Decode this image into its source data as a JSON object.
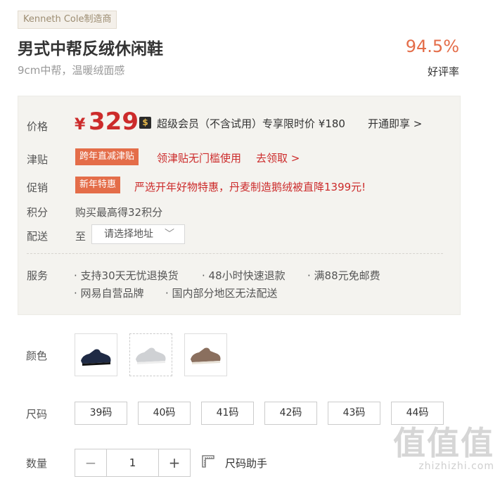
{
  "brand_tag": "Kenneth Cole制造商",
  "product": {
    "title": "男式中帮反绒休闲鞋",
    "subtitle": "9cm中帮，温暖绒面感"
  },
  "rating": {
    "value": "94.5%",
    "label": "好评率"
  },
  "panel": {
    "price_label": "价格",
    "currency": "¥",
    "price": "329",
    "vip_icon": "$",
    "vip_text": "超级会员（不含试用）专享限时价 ¥180",
    "vip_link": "开通即享 >",
    "subsidy_label": "津贴",
    "subsidy_tag": "跨年直减津贴",
    "subsidy_text": "领津贴无门槛使用",
    "subsidy_link": "去领取 >",
    "promo_label": "促销",
    "promo_tag": "新年特惠",
    "promo_text": "严选开年好物特惠，丹麦制造鹅绒被直降1399元!",
    "points_label": "积分",
    "points_text": "购买最高得32积分",
    "delivery_label": "配送",
    "delivery_to": "至",
    "address_placeholder": "请选择地址",
    "service_label": "服务",
    "services": [
      "· 支持30天无忧退换货",
      "· 48小时快速退款",
      "· 满88元免邮费",
      "· 网易自营品牌",
      "· 国内部分地区无法配送"
    ]
  },
  "color": {
    "label": "颜色",
    "options": [
      "navy",
      "white",
      "brown"
    ],
    "colors": {
      "navy": "#1f2a44",
      "white": "#cfd1d4",
      "brown": "#8a6f5e"
    }
  },
  "size": {
    "label": "尺码",
    "options": [
      "39码",
      "40码",
      "41码",
      "42码",
      "43码",
      "44码"
    ]
  },
  "quantity": {
    "label": "数量",
    "minus": "−",
    "value": "1",
    "plus": "+",
    "size_helper": "尺码助手"
  },
  "watermark": {
    "big": "值值值",
    "small": "zhizhizhi.com"
  }
}
